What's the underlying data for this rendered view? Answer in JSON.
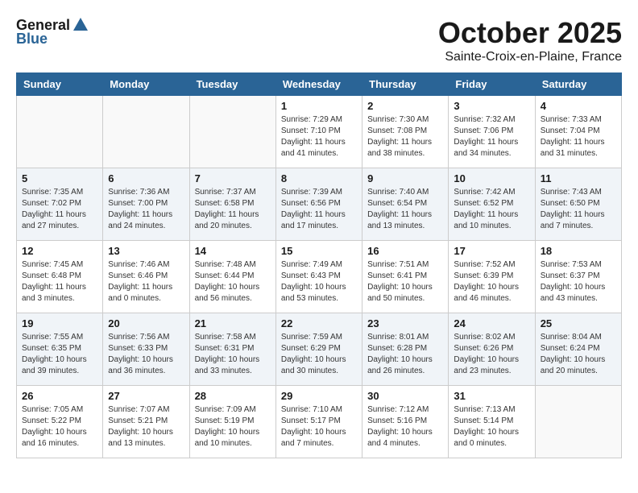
{
  "header": {
    "logo_general": "General",
    "logo_blue": "Blue",
    "month_title": "October 2025",
    "location": "Sainte-Croix-en-Plaine, France"
  },
  "days_of_week": [
    "Sunday",
    "Monday",
    "Tuesday",
    "Wednesday",
    "Thursday",
    "Friday",
    "Saturday"
  ],
  "weeks": [
    [
      {
        "day": "",
        "info": ""
      },
      {
        "day": "",
        "info": ""
      },
      {
        "day": "",
        "info": ""
      },
      {
        "day": "1",
        "info": "Sunrise: 7:29 AM\nSunset: 7:10 PM\nDaylight: 11 hours and 41 minutes."
      },
      {
        "day": "2",
        "info": "Sunrise: 7:30 AM\nSunset: 7:08 PM\nDaylight: 11 hours and 38 minutes."
      },
      {
        "day": "3",
        "info": "Sunrise: 7:32 AM\nSunset: 7:06 PM\nDaylight: 11 hours and 34 minutes."
      },
      {
        "day": "4",
        "info": "Sunrise: 7:33 AM\nSunset: 7:04 PM\nDaylight: 11 hours and 31 minutes."
      }
    ],
    [
      {
        "day": "5",
        "info": "Sunrise: 7:35 AM\nSunset: 7:02 PM\nDaylight: 11 hours and 27 minutes."
      },
      {
        "day": "6",
        "info": "Sunrise: 7:36 AM\nSunset: 7:00 PM\nDaylight: 11 hours and 24 minutes."
      },
      {
        "day": "7",
        "info": "Sunrise: 7:37 AM\nSunset: 6:58 PM\nDaylight: 11 hours and 20 minutes."
      },
      {
        "day": "8",
        "info": "Sunrise: 7:39 AM\nSunset: 6:56 PM\nDaylight: 11 hours and 17 minutes."
      },
      {
        "day": "9",
        "info": "Sunrise: 7:40 AM\nSunset: 6:54 PM\nDaylight: 11 hours and 13 minutes."
      },
      {
        "day": "10",
        "info": "Sunrise: 7:42 AM\nSunset: 6:52 PM\nDaylight: 11 hours and 10 minutes."
      },
      {
        "day": "11",
        "info": "Sunrise: 7:43 AM\nSunset: 6:50 PM\nDaylight: 11 hours and 7 minutes."
      }
    ],
    [
      {
        "day": "12",
        "info": "Sunrise: 7:45 AM\nSunset: 6:48 PM\nDaylight: 11 hours and 3 minutes."
      },
      {
        "day": "13",
        "info": "Sunrise: 7:46 AM\nSunset: 6:46 PM\nDaylight: 11 hours and 0 minutes."
      },
      {
        "day": "14",
        "info": "Sunrise: 7:48 AM\nSunset: 6:44 PM\nDaylight: 10 hours and 56 minutes."
      },
      {
        "day": "15",
        "info": "Sunrise: 7:49 AM\nSunset: 6:43 PM\nDaylight: 10 hours and 53 minutes."
      },
      {
        "day": "16",
        "info": "Sunrise: 7:51 AM\nSunset: 6:41 PM\nDaylight: 10 hours and 50 minutes."
      },
      {
        "day": "17",
        "info": "Sunrise: 7:52 AM\nSunset: 6:39 PM\nDaylight: 10 hours and 46 minutes."
      },
      {
        "day": "18",
        "info": "Sunrise: 7:53 AM\nSunset: 6:37 PM\nDaylight: 10 hours and 43 minutes."
      }
    ],
    [
      {
        "day": "19",
        "info": "Sunrise: 7:55 AM\nSunset: 6:35 PM\nDaylight: 10 hours and 39 minutes."
      },
      {
        "day": "20",
        "info": "Sunrise: 7:56 AM\nSunset: 6:33 PM\nDaylight: 10 hours and 36 minutes."
      },
      {
        "day": "21",
        "info": "Sunrise: 7:58 AM\nSunset: 6:31 PM\nDaylight: 10 hours and 33 minutes."
      },
      {
        "day": "22",
        "info": "Sunrise: 7:59 AM\nSunset: 6:29 PM\nDaylight: 10 hours and 30 minutes."
      },
      {
        "day": "23",
        "info": "Sunrise: 8:01 AM\nSunset: 6:28 PM\nDaylight: 10 hours and 26 minutes."
      },
      {
        "day": "24",
        "info": "Sunrise: 8:02 AM\nSunset: 6:26 PM\nDaylight: 10 hours and 23 minutes."
      },
      {
        "day": "25",
        "info": "Sunrise: 8:04 AM\nSunset: 6:24 PM\nDaylight: 10 hours and 20 minutes."
      }
    ],
    [
      {
        "day": "26",
        "info": "Sunrise: 7:05 AM\nSunset: 5:22 PM\nDaylight: 10 hours and 16 minutes."
      },
      {
        "day": "27",
        "info": "Sunrise: 7:07 AM\nSunset: 5:21 PM\nDaylight: 10 hours and 13 minutes."
      },
      {
        "day": "28",
        "info": "Sunrise: 7:09 AM\nSunset: 5:19 PM\nDaylight: 10 hours and 10 minutes."
      },
      {
        "day": "29",
        "info": "Sunrise: 7:10 AM\nSunset: 5:17 PM\nDaylight: 10 hours and 7 minutes."
      },
      {
        "day": "30",
        "info": "Sunrise: 7:12 AM\nSunset: 5:16 PM\nDaylight: 10 hours and 4 minutes."
      },
      {
        "day": "31",
        "info": "Sunrise: 7:13 AM\nSunset: 5:14 PM\nDaylight: 10 hours and 0 minutes."
      },
      {
        "day": "",
        "info": ""
      }
    ]
  ]
}
